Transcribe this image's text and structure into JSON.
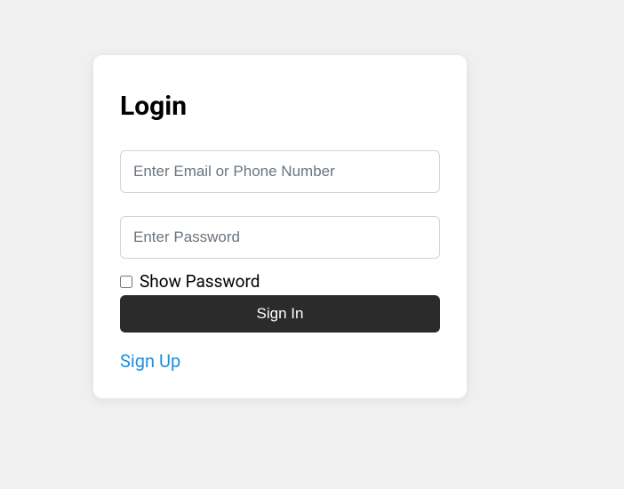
{
  "login": {
    "title": "Login",
    "email_placeholder": "Enter Email or Phone Number",
    "password_placeholder": "Enter Password",
    "show_password_label": "Show Password",
    "signin_button_label": "Sign In",
    "signup_link_label": "Sign Up"
  }
}
